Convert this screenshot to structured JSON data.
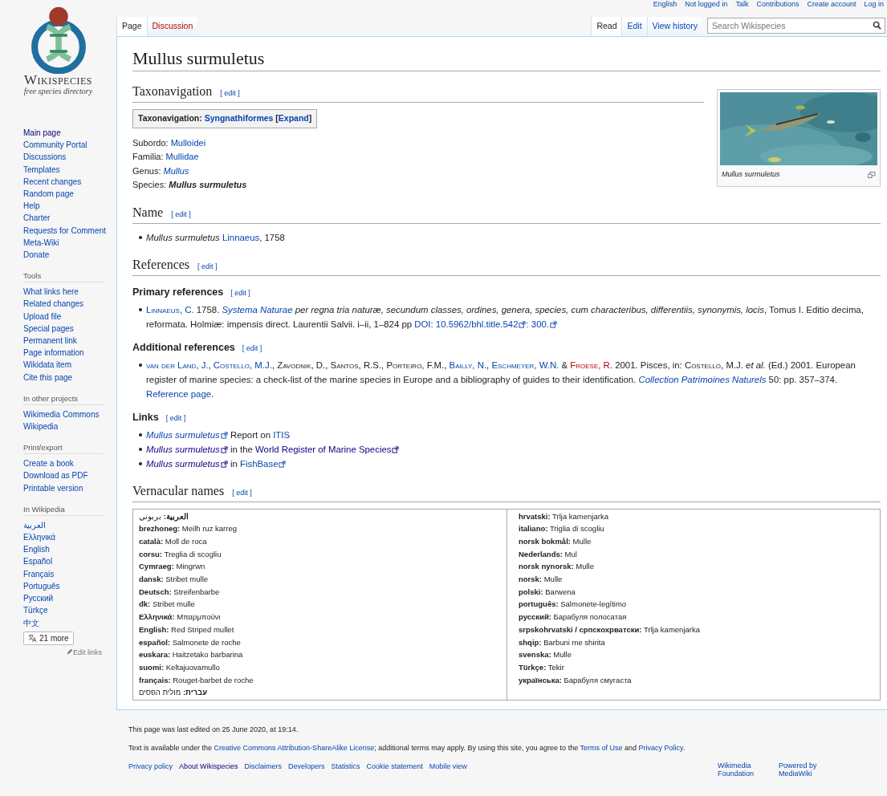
{
  "personal_tools": [
    "English",
    "Not logged in",
    "Talk",
    "Contributions",
    "Create account",
    "Log in"
  ],
  "logo": {
    "wordmark": "Wikispecies",
    "tagline": "free species directory"
  },
  "sidebar": {
    "main_links": [
      {
        "label": "Main page",
        "kind": "visited"
      },
      {
        "label": "Community Portal",
        "kind": "link"
      },
      {
        "label": "Discussions",
        "kind": "link"
      },
      {
        "label": "Templates",
        "kind": "link"
      },
      {
        "label": "Recent changes",
        "kind": "link"
      },
      {
        "label": "Random page",
        "kind": "link"
      },
      {
        "label": "Help",
        "kind": "link"
      },
      {
        "label": "Charter",
        "kind": "link"
      },
      {
        "label": "Requests for Comment",
        "kind": "link"
      },
      {
        "label": "Meta-Wiki",
        "kind": "link"
      },
      {
        "label": "Donate",
        "kind": "link"
      }
    ],
    "portals": [
      {
        "heading": "Tools",
        "items": [
          "What links here",
          "Related changes",
          "Upload file",
          "Special pages",
          "Permanent link",
          "Page information",
          "Wikidata item",
          "Cite this page"
        ]
      },
      {
        "heading": "In other projects",
        "items": [
          "Wikimedia Commons",
          "Wikipedia"
        ]
      },
      {
        "heading": "Print/export",
        "items": [
          "Create a book",
          "Download as PDF",
          "Printable version"
        ]
      },
      {
        "heading": "In Wikipedia",
        "items": [
          "العربية",
          "Ελληνικά",
          "English",
          "Español",
          "Français",
          "Português",
          "Русский",
          "Türkçe",
          "中文"
        ]
      }
    ],
    "more_languages": "21 more",
    "edit_links": "Edit links"
  },
  "tabs_left": [
    {
      "label": "Page",
      "kind": "link",
      "selected": true
    },
    {
      "label": "Discussion",
      "kind": "new",
      "selected": false
    }
  ],
  "tabs_right": [
    {
      "label": "Read",
      "selected": true
    },
    {
      "label": "Edit",
      "selected": false
    },
    {
      "label": "View history",
      "selected": false
    }
  ],
  "search": {
    "placeholder": "Search Wikispecies"
  },
  "title": "Mullus surmuletus",
  "figure": {
    "kind": "picture",
    "caption": "Mullus surmuletus"
  },
  "blocks": [
    {
      "kind": "h2",
      "text": "Taxonavigation",
      "edit": "[ edit ]"
    },
    {
      "kind": "navbox",
      "segments": [
        {
          "text": "Taxonavigation: ",
          "kind": "text",
          "bold": true
        },
        {
          "text": "Syngnathiformes",
          "kind": "link",
          "bold": true
        },
        {
          "text": " [",
          "kind": "text",
          "bold": true
        },
        {
          "text": "Expand",
          "kind": "link",
          "bold": true
        },
        {
          "text": "]",
          "kind": "text",
          "bold": true
        }
      ]
    },
    {
      "kind": "lines",
      "lines": [
        [
          {
            "text": "Subordo: ",
            "kind": "text"
          },
          {
            "text": "Mulloidei",
            "kind": "link"
          }
        ],
        [
          {
            "text": "Familia: ",
            "kind": "text"
          },
          {
            "text": "Mullidae",
            "kind": "link"
          }
        ],
        [
          {
            "text": "Genus: ",
            "kind": "text"
          },
          {
            "text": "Mullus",
            "kind": "link",
            "italic": true
          }
        ],
        [
          {
            "text": "Species: ",
            "kind": "text"
          },
          {
            "text": "Mullus surmuletus",
            "kind": "text",
            "italic": true,
            "bold": true
          }
        ]
      ]
    },
    {
      "kind": "h2",
      "text": "Name",
      "edit": "[ edit ]"
    },
    {
      "kind": "bullets",
      "items": [
        [
          {
            "text": "Mullus surmuletus ",
            "kind": "text",
            "italic": true
          },
          {
            "text": "Linnaeus",
            "kind": "link"
          },
          {
            "text": ", 1758",
            "kind": "text"
          }
        ]
      ]
    },
    {
      "kind": "h2",
      "text": "References",
      "edit": "[ edit ]"
    },
    {
      "kind": "h3",
      "text": "Primary references",
      "edit": "[ edit ]"
    },
    {
      "kind": "bullets",
      "items": [
        [
          {
            "text": "Linnaeus, C.",
            "kind": "link",
            "caps": true
          },
          {
            "text": " 1758. ",
            "kind": "text"
          },
          {
            "text": "Systema Naturae",
            "kind": "link",
            "italic": true
          },
          {
            "text": " per regna tria naturæ, secundum classes, ordines, genera, species, cum characteribus, differentiis, synonymis, locis",
            "kind": "text",
            "italic": true
          },
          {
            "text": ", Tomus I. Editio decima, reformata. Holmiæ: impensis direct. Laurentii Salvii. i–ii, 1–824 pp  ",
            "kind": "text"
          },
          {
            "text": "DOI: 10.5962/bhl.title.542",
            "kind": "link",
            "external": true
          },
          {
            "text": ": 300.",
            "kind": "link",
            "external": true
          }
        ]
      ]
    },
    {
      "kind": "h3",
      "text": "Additional references",
      "edit": "[ edit ]"
    },
    {
      "kind": "bullets",
      "items": [
        [
          {
            "text": "van der Land, J.",
            "kind": "link",
            "caps": true
          },
          {
            "text": ", ",
            "kind": "text"
          },
          {
            "text": "Costello, M.J.",
            "kind": "link",
            "caps": true
          },
          {
            "text": ", ",
            "kind": "text"
          },
          {
            "text": "Zavodnik, D.",
            "kind": "text",
            "caps": true
          },
          {
            "text": ", ",
            "kind": "text"
          },
          {
            "text": "Santos, R.S.",
            "kind": "text",
            "caps": true
          },
          {
            "text": ", ",
            "kind": "text"
          },
          {
            "text": "Porteiro, F.M.",
            "kind": "text",
            "caps": true
          },
          {
            "text": ", ",
            "kind": "text"
          },
          {
            "text": "Bailly, N.",
            "kind": "link",
            "caps": true
          },
          {
            "text": ", ",
            "kind": "text"
          },
          {
            "text": "Eschmeyer, W.N.",
            "kind": "link",
            "caps": true
          },
          {
            "text": " & ",
            "kind": "text"
          },
          {
            "text": "Froese, R.",
            "kind": "new",
            "caps": true
          },
          {
            "text": " 2001. Pisces, in: ",
            "kind": "text"
          },
          {
            "text": "Costello, M.J. ",
            "kind": "text",
            "caps": true
          },
          {
            "text": "et al.",
            "kind": "text",
            "italic": true
          },
          {
            "text": " (Ed.) 2001. European register of marine species: a check-list of the marine species in Europe and a bibliography of guides to their identification. ",
            "kind": "text"
          },
          {
            "text": "Collection Patrimoines Naturels",
            "kind": "link",
            "italic": true
          },
          {
            "text": " 50: pp. 357–374. ",
            "kind": "text"
          },
          {
            "text": "Reference page",
            "kind": "link"
          },
          {
            "text": ".",
            "kind": "text"
          }
        ]
      ]
    },
    {
      "kind": "h3",
      "text": "Links",
      "edit": "[ edit ]"
    },
    {
      "kind": "bullets",
      "items": [
        [
          {
            "text": "Mullus surmuletus",
            "kind": "link",
            "italic": true,
            "external": true
          },
          {
            "text": " Report on ",
            "kind": "text"
          },
          {
            "text": "ITIS",
            "kind": "link"
          }
        ],
        [
          {
            "text": "Mullus surmuletus",
            "kind": "visited",
            "italic": true,
            "external": true
          },
          {
            "text": " in the ",
            "kind": "text"
          },
          {
            "text": "World Register of Marine Species",
            "kind": "visited",
            "external": true
          }
        ],
        [
          {
            "text": "Mullus surmuletus",
            "kind": "visited",
            "italic": true,
            "external": true
          },
          {
            "text": " in ",
            "kind": "text"
          },
          {
            "text": "FishBase",
            "kind": "link",
            "external": true
          }
        ]
      ]
    },
    {
      "kind": "h2",
      "text": "Vernacular names",
      "edit": "[ edit ]"
    },
    {
      "kind": "vernacular",
      "columns": [
        [
          {
            "lang": "العربية:",
            "name": "بربوني"
          },
          {
            "lang": "brezhoneg:",
            "name": "Meilh ruz karreg"
          },
          {
            "lang": "català:",
            "name": "Moll de roca"
          },
          {
            "lang": "corsu:",
            "name": "Treglia di scogliu"
          },
          {
            "lang": "Cymraeg:",
            "name": "Mingrwn"
          },
          {
            "lang": "dansk:",
            "name": "Stribet mulle"
          },
          {
            "lang": "Deutsch:",
            "name": "Streifenbarbe"
          },
          {
            "lang": "dk:",
            "name": "Stribet mulle"
          },
          {
            "lang": "Ελληνικά:",
            "name": "Μπαρμπούνι"
          },
          {
            "lang": "English:",
            "name": "Red Striped mullet"
          },
          {
            "lang": "español:",
            "name": "Salmonete de roche"
          },
          {
            "lang": "euskara:",
            "name": "Haitzetako barbarina"
          },
          {
            "lang": "suomi:",
            "name": "Keltajuovamullo"
          },
          {
            "lang": "français:",
            "name": "Rouget-barbet de roche"
          },
          {
            "lang": "עברית:",
            "name": "מולית הפסים"
          }
        ],
        [
          {
            "lang": "hrvatski:",
            "name": "Trlja kamenjarka"
          },
          {
            "lang": "italiano:",
            "name": "Triglia di scogliu"
          },
          {
            "lang": "norsk bokmål:",
            "name": "Mulle"
          },
          {
            "lang": "Nederlands:",
            "name": "Mul"
          },
          {
            "lang": "norsk nynorsk:",
            "name": "Mulle"
          },
          {
            "lang": "norsk:",
            "name": "Mulle"
          },
          {
            "lang": "polski:",
            "name": "Barwena"
          },
          {
            "lang": "português:",
            "name": "Salmonete-legítimo"
          },
          {
            "lang": "русский:",
            "name": "Барабуля полосатая"
          },
          {
            "lang": "srpskohrvatski / српскохрватски:",
            "name": "Trlja kamenjarka"
          },
          {
            "lang": "shqip:",
            "name": "Barbuni me shirita"
          },
          {
            "lang": "svenska:",
            "name": "Mulle"
          },
          {
            "lang": "Türkçe:",
            "name": "Tekir"
          },
          {
            "lang": "українська:",
            "name": "Барабуля смугаста"
          }
        ]
      ]
    }
  ],
  "footer": {
    "last_edited": "This page was last edited on 25 June 2020, at 19:14.",
    "license": [
      {
        "text": "Text is available under the ",
        "kind": "text"
      },
      {
        "text": "Creative Commons Attribution-ShareAlike License",
        "kind": "link"
      },
      {
        "text": "; additional terms may apply. By using this site, you agree to the ",
        "kind": "text"
      },
      {
        "text": "Terms of Use",
        "kind": "link"
      },
      {
        "text": " and ",
        "kind": "text"
      },
      {
        "text": "Privacy Policy",
        "kind": "link"
      },
      {
        "text": ".",
        "kind": "text"
      }
    ],
    "links": [
      {
        "label": "Privacy policy",
        "kind": "link"
      },
      {
        "label": "About Wikispecies",
        "kind": "visited"
      },
      {
        "label": "Disclaimers",
        "kind": "link"
      },
      {
        "label": "Developers",
        "kind": "link"
      },
      {
        "label": "Statistics",
        "kind": "link"
      },
      {
        "label": "Cookie statement",
        "kind": "link"
      },
      {
        "label": "Mobile view",
        "kind": "link"
      }
    ],
    "badges": [
      "Wikimedia Foundation",
      "Powered by MediaWiki"
    ]
  }
}
